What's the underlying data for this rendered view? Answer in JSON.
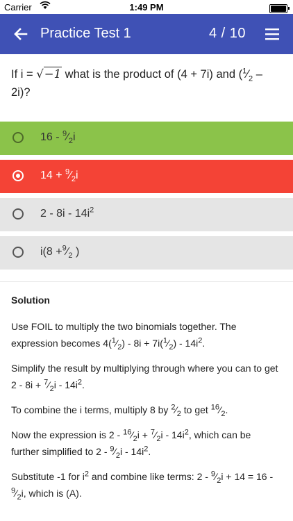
{
  "status": {
    "carrier": "Carrier",
    "time": "1:49 PM"
  },
  "header": {
    "title": "Practice Test 1",
    "counter": "4  / 10"
  },
  "question": {
    "pre": "If i = ",
    "radical": "−1",
    "post_a": " what is the product of (4 + 7i) and (",
    "frac_num": "1",
    "frac_den": "2",
    "post_b": " – 2i)?"
  },
  "options": [
    {
      "state": "correct",
      "parts": [
        "16 - ",
        "9",
        "2",
        "i"
      ]
    },
    {
      "state": "selected-wrong",
      "parts": [
        "14 + ",
        "9",
        "2",
        "i"
      ]
    },
    {
      "text": "2 - 8i - 14i",
      "sup": "2"
    },
    {
      "parts": [
        "i(8 +",
        "9",
        "2",
        " )"
      ]
    }
  ],
  "solution": {
    "heading": "Solution",
    "p1": {
      "a": "Use FOIL to multiply the two binomials together. The expression becomes 4(",
      "n1": "1",
      "d1": "2",
      "b": ") - 8i + 7i(",
      "n2": "1",
      "d2": "2",
      "c": ") - 14i",
      "sup": "2",
      "d": "."
    },
    "p2": {
      "a": "Simplify the result by multiplying through where you can to get 2 - 8i + ",
      "n": "7",
      "dd": "2",
      "b": "i - 14i",
      "sup": "2",
      "c": "."
    },
    "p3": {
      "a": "To combine the i terms, multiply 8 by ",
      "n1": "2",
      "d1": "2",
      "b": " to get ",
      "n2": "16",
      "d2": "2",
      "c": "."
    },
    "p4": {
      "a": "Now the expression is 2 - ",
      "n1": "16",
      "d1": "2",
      "b": "i + ",
      "n2": "7",
      "d2": "2",
      "c": "i - 14i",
      "sup": "2",
      "d": ", which can be further simplified to 2 - ",
      "n3": "9",
      "d3": "2",
      "e": "i - 14i",
      "sup2": "2",
      "f": "."
    },
    "p5": {
      "a": "Substitute -1 for i",
      "sup": "2",
      "b": " and combine like terms: 2 - ",
      "n1": "9",
      "d1": "2",
      "c": "i + 14 = 16 - ",
      "n2": "9",
      "d2": "2",
      "d": "i, which is (A)."
    }
  },
  "colors": {
    "appbar": "#3f51b5",
    "correct": "#8bc34a",
    "wrong": "#f44336",
    "neutral": "#e5e5e5"
  },
  "icons": {
    "back": "arrow-left-icon",
    "menu": "hamburger-menu-icon",
    "wifi": "wifi-icon",
    "battery": "battery-icon"
  }
}
